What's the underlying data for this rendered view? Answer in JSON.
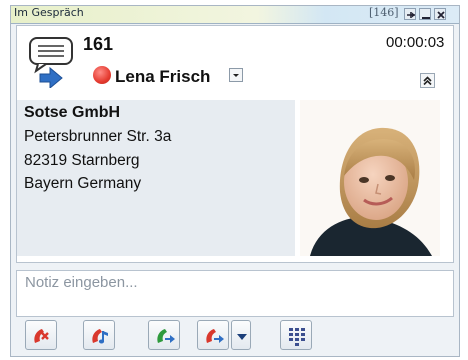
{
  "window": {
    "title": "Im Gespräch",
    "counter": "[146]"
  },
  "call": {
    "number": "161",
    "duration": "00:00:03",
    "contact_name": "Lena Frisch"
  },
  "contact": {
    "company": "Sotse GmbH",
    "street": "Petersbrunner Str. 3a",
    "city": "82319 Starnberg",
    "region": "Bayern Germany"
  },
  "note": {
    "placeholder": "Notiz eingeben..."
  },
  "icons": {
    "status": "busy-red-dot",
    "call_direction": "incoming-arrow-icon",
    "buttons": [
      "hangup-icon",
      "hold-music-icon",
      "transfer-call-icon",
      "forward-call-icon",
      "dialpad-icon"
    ]
  },
  "colors": {
    "status_busy": "#e53b30",
    "phone_red": "#d9382d",
    "phone_green": "#2e9a3c",
    "arrow_blue": "#2f6fc4"
  }
}
